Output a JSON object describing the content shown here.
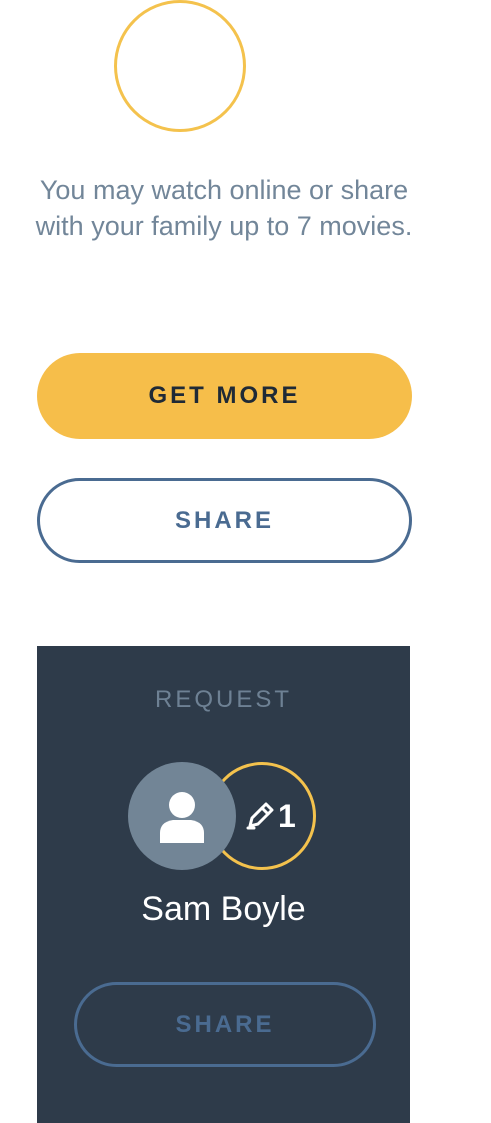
{
  "info": {
    "text": "You may watch online or share with your family up to 7 movies."
  },
  "buttons": {
    "get_more_label": "GET MORE",
    "share_label": "SHARE"
  },
  "request_card": {
    "title": "REQUEST",
    "user_name": "Sam Boyle",
    "count": "1",
    "share_label": "SHARE"
  },
  "colors": {
    "accent_yellow": "#f6be4a",
    "accent_blue": "#4a6b91",
    "card_background": "#2e3b4a",
    "text_muted": "#728699"
  },
  "icons": {
    "avatar": "user-silhouette-icon",
    "ticket": "pencil-ticket-icon"
  }
}
